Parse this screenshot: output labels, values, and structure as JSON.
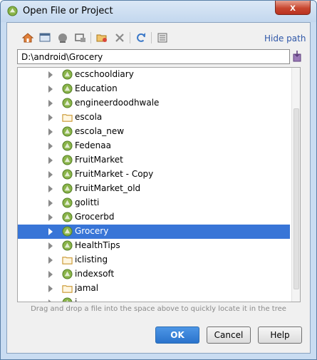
{
  "window": {
    "title": "Open File or Project",
    "close_glyph": "x"
  },
  "toolbar": {
    "icons": [
      "home-icon",
      "desktop-icon",
      "project-icon",
      "module-icon",
      "new-folder-icon",
      "delete-icon",
      "refresh-icon",
      "show-hidden-icon"
    ],
    "hide_path_label": "Hide path"
  },
  "path": {
    "value": "D:\\android\\Grocery"
  },
  "tree": {
    "items": [
      {
        "label": "ecschooldiary",
        "icon": "android-project-icon",
        "selected": false
      },
      {
        "label": "Education",
        "icon": "android-project-icon",
        "selected": false
      },
      {
        "label": "engineerdoodhwale",
        "icon": "android-project-icon",
        "selected": false
      },
      {
        "label": "escola",
        "icon": "folder-icon",
        "selected": false
      },
      {
        "label": "escola_new",
        "icon": "android-project-icon",
        "selected": false
      },
      {
        "label": "Fedenaa",
        "icon": "android-project-icon",
        "selected": false
      },
      {
        "label": "FruitMarket",
        "icon": "android-project-icon",
        "selected": false
      },
      {
        "label": "FruitMarket - Copy",
        "icon": "android-project-icon",
        "selected": false
      },
      {
        "label": "FruitMarket_old",
        "icon": "android-project-icon",
        "selected": false
      },
      {
        "label": "golitti",
        "icon": "android-project-icon",
        "selected": false
      },
      {
        "label": "Grocerbd",
        "icon": "android-project-icon",
        "selected": false
      },
      {
        "label": "Grocery",
        "icon": "android-project-icon",
        "selected": true
      },
      {
        "label": "HealthTips",
        "icon": "android-project-icon",
        "selected": false
      },
      {
        "label": "iclisting",
        "icon": "folder-icon",
        "selected": false
      },
      {
        "label": "indexsoft",
        "icon": "android-project-icon",
        "selected": false
      },
      {
        "label": "jamal",
        "icon": "folder-icon",
        "selected": false
      },
      {
        "label": "j...",
        "icon": "android-project-icon",
        "selected": false
      }
    ]
  },
  "hint": "Drag and drop a file into the space above to quickly locate it in the tree",
  "buttons": {
    "ok": "OK",
    "cancel": "Cancel",
    "help": "Help"
  },
  "colors": {
    "selection": "#3875d7",
    "android_green": "#8ab44a",
    "link": "#2f57a8"
  }
}
